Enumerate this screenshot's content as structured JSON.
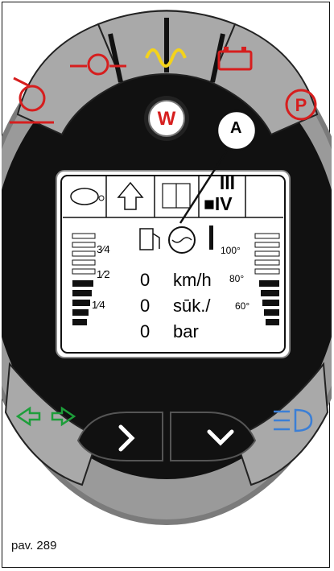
{
  "figure": {
    "caption": "pav. 289",
    "callout_label": "A"
  },
  "top_icons": [
    {
      "name": "axle-warning-icon",
      "color": "#d61e1e"
    },
    {
      "name": "oil-pressure-icon",
      "color": "#d61e1e"
    },
    {
      "name": "glow-plug-icon",
      "color": "#f4d31b"
    },
    {
      "name": "battery-icon",
      "color": "#d61e1e"
    },
    {
      "name": "parking-brake-icon",
      "color": "#d61e1e",
      "text": "P"
    }
  ],
  "center_badge": {
    "text": "W",
    "color": "#d61e1e"
  },
  "display": {
    "icons": [
      "turtle-icon",
      "up-arrow-icon",
      "four-wheel-drive-icon"
    ],
    "gear": {
      "line1": "III",
      "line2": "■IV"
    },
    "fuel_labels": {
      "three_quarter": "3/4",
      "half": "1/2",
      "quarter": "1/4"
    },
    "fuel_marks": [
      {
        "num": "3",
        "den": "4"
      },
      {
        "num": "1",
        "den": "2"
      },
      {
        "num": "1",
        "den": "4"
      }
    ],
    "temp_labels": [
      "100°",
      "80°",
      "60°"
    ],
    "readouts": [
      {
        "value": "0",
        "unit": "km/h"
      },
      {
        "value": "0",
        "unit": "sūk./"
      },
      {
        "value": "0",
        "unit": "bar"
      }
    ]
  },
  "bottom": {
    "left_icon": "turn-signal-icon",
    "left_color": "#1d9e3a",
    "right_icon": "headlight-icon",
    "right_color": "#3b7fd6",
    "next_button": "chevron-right-icon",
    "down_button": "chevron-down-icon"
  }
}
